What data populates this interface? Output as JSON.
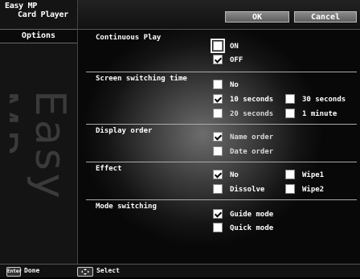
{
  "app": {
    "logo_line1": "Easy MP",
    "logo_line2": "Card Player",
    "watermark": "Easy MP"
  },
  "sidebar": {
    "options_label": "Options"
  },
  "header": {
    "ok_label": "OK",
    "cancel_label": "Cancel"
  },
  "sections": {
    "continuous_play": {
      "title": "Continuous Play",
      "on": "ON",
      "off": "OFF",
      "on_checked": false,
      "off_checked": true
    },
    "screen_switching": {
      "title": "Screen switching time",
      "no": "No",
      "s10": "10 seconds",
      "s30": "30 seconds",
      "s20": "20 seconds",
      "m1": "1 minute",
      "selected": "10 seconds"
    },
    "display_order": {
      "title": "Display order",
      "name": "Name order",
      "date": "Date order",
      "selected": "Name order"
    },
    "effect": {
      "title": "Effect",
      "no": "No",
      "wipe1": "Wipe1",
      "dissolve": "Dissolve",
      "wipe2": "Wipe2",
      "selected": "No"
    },
    "mode_switching": {
      "title": "Mode switching",
      "guide": "Guide mode",
      "quick": "Quick mode",
      "selected": "Guide mode"
    }
  },
  "footer": {
    "enter_key": "Enter",
    "done_label": "Done",
    "select_label": "Select"
  },
  "colors": {
    "background": "#000000",
    "button": "#7a7a7a",
    "text": "#ffffff"
  }
}
